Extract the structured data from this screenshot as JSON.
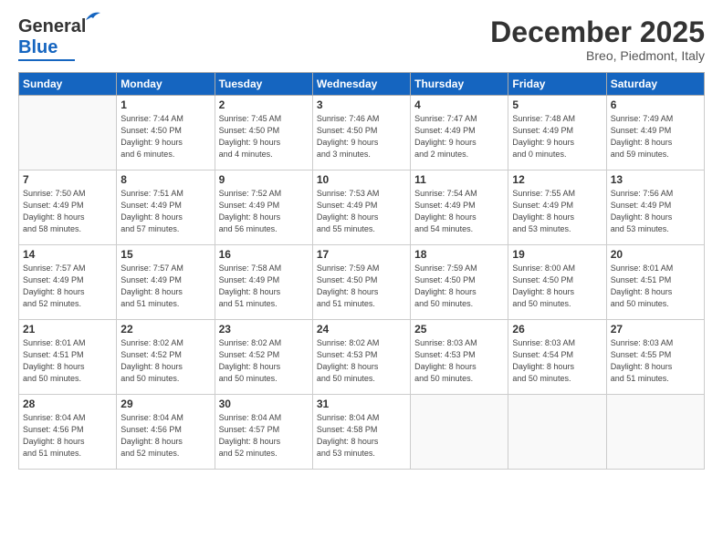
{
  "logo": {
    "general": "General",
    "blue": "Blue"
  },
  "title": "December 2025",
  "subtitle": "Breo, Piedmont, Italy",
  "weekdays": [
    "Sunday",
    "Monday",
    "Tuesday",
    "Wednesday",
    "Thursday",
    "Friday",
    "Saturday"
  ],
  "weeks": [
    [
      {
        "day": "",
        "detail": ""
      },
      {
        "day": "1",
        "detail": "Sunrise: 7:44 AM\nSunset: 4:50 PM\nDaylight: 9 hours\nand 6 minutes."
      },
      {
        "day": "2",
        "detail": "Sunrise: 7:45 AM\nSunset: 4:50 PM\nDaylight: 9 hours\nand 4 minutes."
      },
      {
        "day": "3",
        "detail": "Sunrise: 7:46 AM\nSunset: 4:50 PM\nDaylight: 9 hours\nand 3 minutes."
      },
      {
        "day": "4",
        "detail": "Sunrise: 7:47 AM\nSunset: 4:49 PM\nDaylight: 9 hours\nand 2 minutes."
      },
      {
        "day": "5",
        "detail": "Sunrise: 7:48 AM\nSunset: 4:49 PM\nDaylight: 9 hours\nand 0 minutes."
      },
      {
        "day": "6",
        "detail": "Sunrise: 7:49 AM\nSunset: 4:49 PM\nDaylight: 8 hours\nand 59 minutes."
      }
    ],
    [
      {
        "day": "7",
        "detail": "Sunrise: 7:50 AM\nSunset: 4:49 PM\nDaylight: 8 hours\nand 58 minutes."
      },
      {
        "day": "8",
        "detail": "Sunrise: 7:51 AM\nSunset: 4:49 PM\nDaylight: 8 hours\nand 57 minutes."
      },
      {
        "day": "9",
        "detail": "Sunrise: 7:52 AM\nSunset: 4:49 PM\nDaylight: 8 hours\nand 56 minutes."
      },
      {
        "day": "10",
        "detail": "Sunrise: 7:53 AM\nSunset: 4:49 PM\nDaylight: 8 hours\nand 55 minutes."
      },
      {
        "day": "11",
        "detail": "Sunrise: 7:54 AM\nSunset: 4:49 PM\nDaylight: 8 hours\nand 54 minutes."
      },
      {
        "day": "12",
        "detail": "Sunrise: 7:55 AM\nSunset: 4:49 PM\nDaylight: 8 hours\nand 53 minutes."
      },
      {
        "day": "13",
        "detail": "Sunrise: 7:56 AM\nSunset: 4:49 PM\nDaylight: 8 hours\nand 53 minutes."
      }
    ],
    [
      {
        "day": "14",
        "detail": "Sunrise: 7:57 AM\nSunset: 4:49 PM\nDaylight: 8 hours\nand 52 minutes."
      },
      {
        "day": "15",
        "detail": "Sunrise: 7:57 AM\nSunset: 4:49 PM\nDaylight: 8 hours\nand 51 minutes."
      },
      {
        "day": "16",
        "detail": "Sunrise: 7:58 AM\nSunset: 4:49 PM\nDaylight: 8 hours\nand 51 minutes."
      },
      {
        "day": "17",
        "detail": "Sunrise: 7:59 AM\nSunset: 4:50 PM\nDaylight: 8 hours\nand 51 minutes."
      },
      {
        "day": "18",
        "detail": "Sunrise: 7:59 AM\nSunset: 4:50 PM\nDaylight: 8 hours\nand 50 minutes."
      },
      {
        "day": "19",
        "detail": "Sunrise: 8:00 AM\nSunset: 4:50 PM\nDaylight: 8 hours\nand 50 minutes."
      },
      {
        "day": "20",
        "detail": "Sunrise: 8:01 AM\nSunset: 4:51 PM\nDaylight: 8 hours\nand 50 minutes."
      }
    ],
    [
      {
        "day": "21",
        "detail": "Sunrise: 8:01 AM\nSunset: 4:51 PM\nDaylight: 8 hours\nand 50 minutes."
      },
      {
        "day": "22",
        "detail": "Sunrise: 8:02 AM\nSunset: 4:52 PM\nDaylight: 8 hours\nand 50 minutes."
      },
      {
        "day": "23",
        "detail": "Sunrise: 8:02 AM\nSunset: 4:52 PM\nDaylight: 8 hours\nand 50 minutes."
      },
      {
        "day": "24",
        "detail": "Sunrise: 8:02 AM\nSunset: 4:53 PM\nDaylight: 8 hours\nand 50 minutes."
      },
      {
        "day": "25",
        "detail": "Sunrise: 8:03 AM\nSunset: 4:53 PM\nDaylight: 8 hours\nand 50 minutes."
      },
      {
        "day": "26",
        "detail": "Sunrise: 8:03 AM\nSunset: 4:54 PM\nDaylight: 8 hours\nand 50 minutes."
      },
      {
        "day": "27",
        "detail": "Sunrise: 8:03 AM\nSunset: 4:55 PM\nDaylight: 8 hours\nand 51 minutes."
      }
    ],
    [
      {
        "day": "28",
        "detail": "Sunrise: 8:04 AM\nSunset: 4:56 PM\nDaylight: 8 hours\nand 51 minutes."
      },
      {
        "day": "29",
        "detail": "Sunrise: 8:04 AM\nSunset: 4:56 PM\nDaylight: 8 hours\nand 52 minutes."
      },
      {
        "day": "30",
        "detail": "Sunrise: 8:04 AM\nSunset: 4:57 PM\nDaylight: 8 hours\nand 52 minutes."
      },
      {
        "day": "31",
        "detail": "Sunrise: 8:04 AM\nSunset: 4:58 PM\nDaylight: 8 hours\nand 53 minutes."
      },
      {
        "day": "",
        "detail": ""
      },
      {
        "day": "",
        "detail": ""
      },
      {
        "day": "",
        "detail": ""
      }
    ]
  ]
}
